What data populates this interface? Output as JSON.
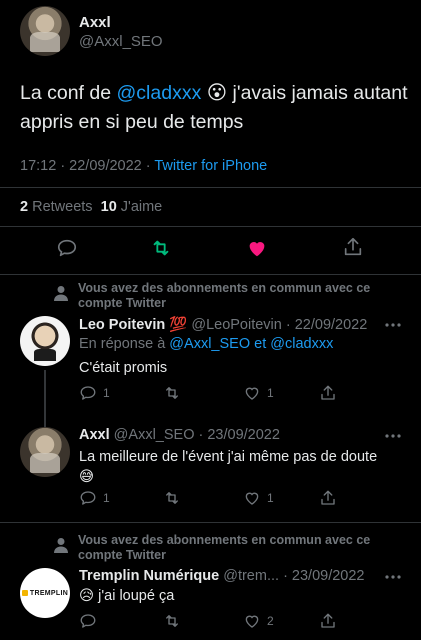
{
  "main_tweet": {
    "display_name": "Axxl",
    "handle": "@Axxl_SEO",
    "text_before": "La conf de ",
    "mention": "@cladxxx",
    "emoji": "😮",
    "text_after": " j'avais jamais autant appris en si peu de temps",
    "time": "17:12 · 22/09/2022 · ",
    "source": "Twitter for iPhone",
    "retweets_count": "2",
    "retweets_label": "Retweets",
    "likes_count": "10",
    "likes_label": "J'aime"
  },
  "replies": [
    {
      "context": "Vous avez des abonnements en commun avec ce compte Twitter",
      "display_name": "Leo Poitevin",
      "badge": "💯",
      "handle": "@LeoPoitevin · 22/09/2022",
      "reply_prefix": "En réponse à ",
      "reply_to_1": "@Axxl_SEO",
      "reply_and": " et ",
      "reply_to_2": "@cladxxx",
      "text": "C'était promis",
      "reply_count": "1",
      "like_count": "1"
    },
    {
      "display_name": "Axxl",
      "handle": "@Axxl_SEO · 23/09/2022",
      "text": "La meilleure de l'évent j'ai même pas de doute",
      "emoji": "😅",
      "reply_count": "1",
      "like_count": "1"
    },
    {
      "context": "Vous avez des abonnements en commun avec ce compte Twitter",
      "display_name": "Tremplin Numérique",
      "handle": "@trem... · 23/09/2022",
      "emoji": "😥",
      "text": " j'ai loupé ça",
      "like_count": "2",
      "avatar_text": "TREMPLIN"
    }
  ],
  "more_icon": "more-dots-icon",
  "colors": {
    "like": "#f91880",
    "retweet": "#00ba7c",
    "link": "#1d9bf0",
    "muted": "#71767b"
  }
}
